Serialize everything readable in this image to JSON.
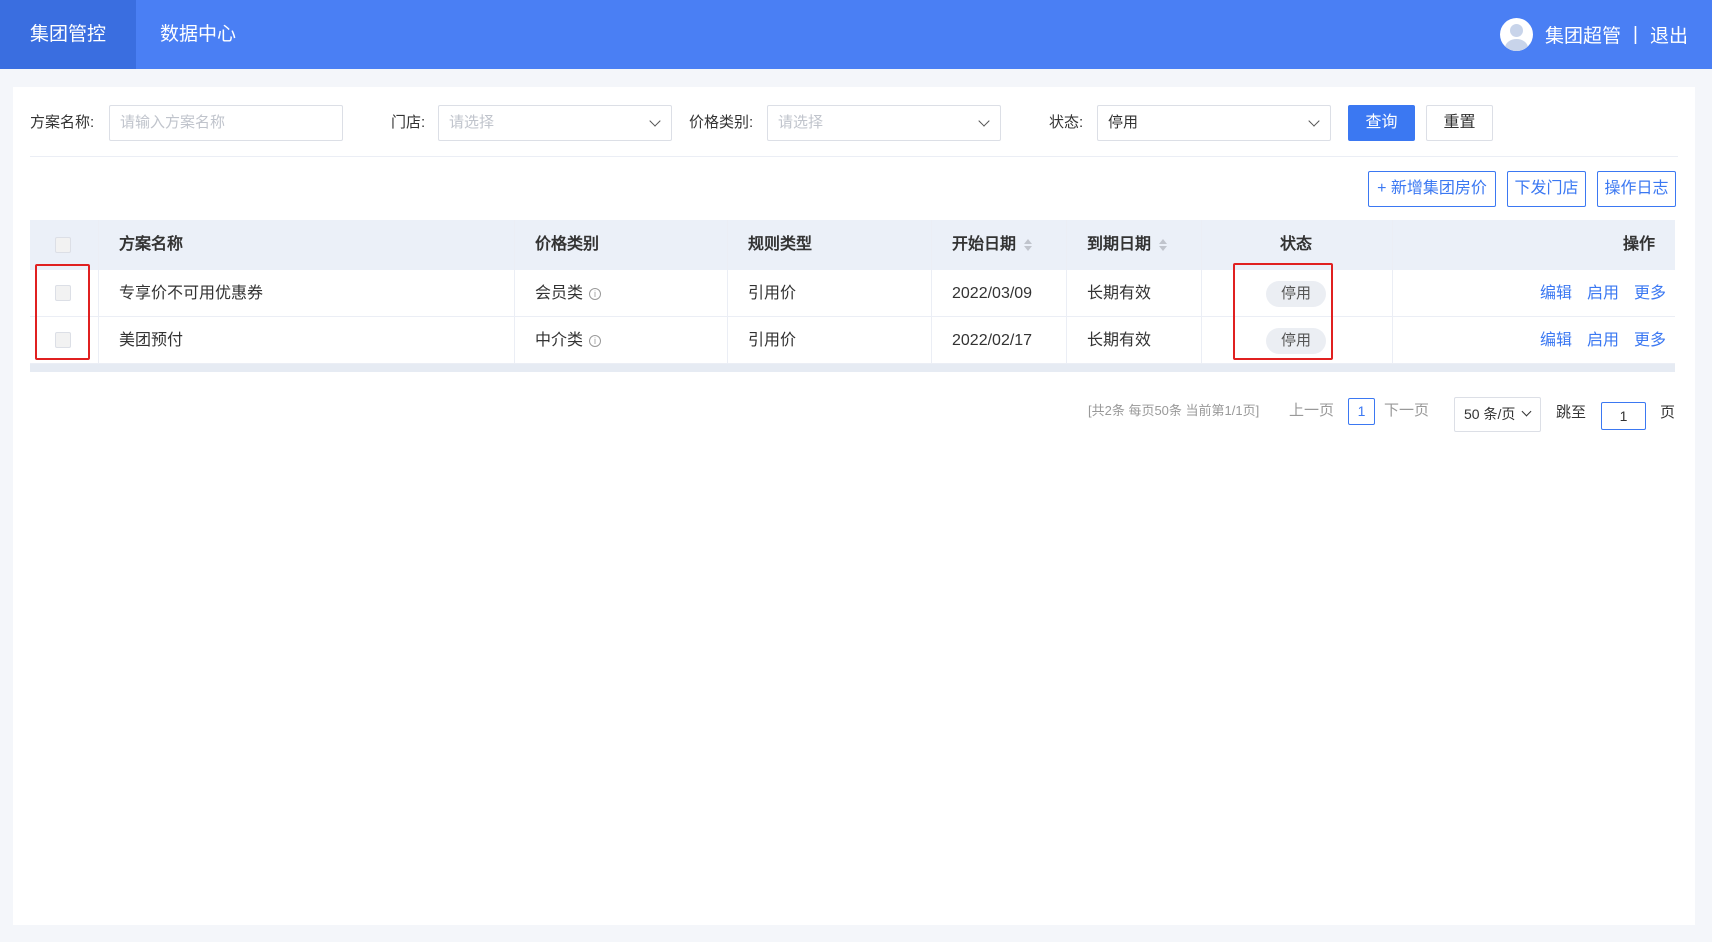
{
  "header": {
    "tabs": [
      {
        "label": "集团管控",
        "active": true
      },
      {
        "label": "数据中心",
        "active": false
      }
    ],
    "user_name": "集团超管",
    "separator": "|",
    "logout_label": "退出",
    "accent_color": "#4a7ff4"
  },
  "filters": {
    "plan_name_label": "方案名称:",
    "plan_name_placeholder": "请输入方案名称",
    "store_label": "门店:",
    "store_placeholder": "请选择",
    "price_type_label": "价格类别:",
    "price_type_placeholder": "请选择",
    "status_label": "状态:",
    "status_value": "停用",
    "query_label": "查询",
    "reset_label": "重置"
  },
  "toolbar": {
    "add_label": "+ 新增集团房价",
    "dispatch_label": "下发门店",
    "log_label": "操作日志"
  },
  "table": {
    "columns": {
      "plan_name": "方案名称",
      "price_type": "价格类别",
      "rule_type": "规则类型",
      "start_date": "开始日期",
      "end_date": "到期日期",
      "status": "状态",
      "actions": "操作"
    },
    "rows": [
      {
        "plan_name": "专享价不可用优惠券",
        "price_type": "会员类",
        "rule_type": "引用价",
        "start_date": "2022/03/09",
        "end_date": "长期有效",
        "status": "停用"
      },
      {
        "plan_name": "美团预付",
        "price_type": "中介类",
        "rule_type": "引用价",
        "start_date": "2022/02/17",
        "end_date": "长期有效",
        "status": "停用"
      }
    ],
    "actions": {
      "edit": "编辑",
      "enable": "启用",
      "more": "更多"
    },
    "info_glyph": "i"
  },
  "pagination": {
    "summary": "[共2条 每页50条 当前第1/1页]",
    "prev_label": "上一页",
    "current_page": "1",
    "next_label": "下一页",
    "page_size": "50 条/页",
    "jump_label": "跳至",
    "jump_value": "1",
    "page_suffix": "页"
  }
}
